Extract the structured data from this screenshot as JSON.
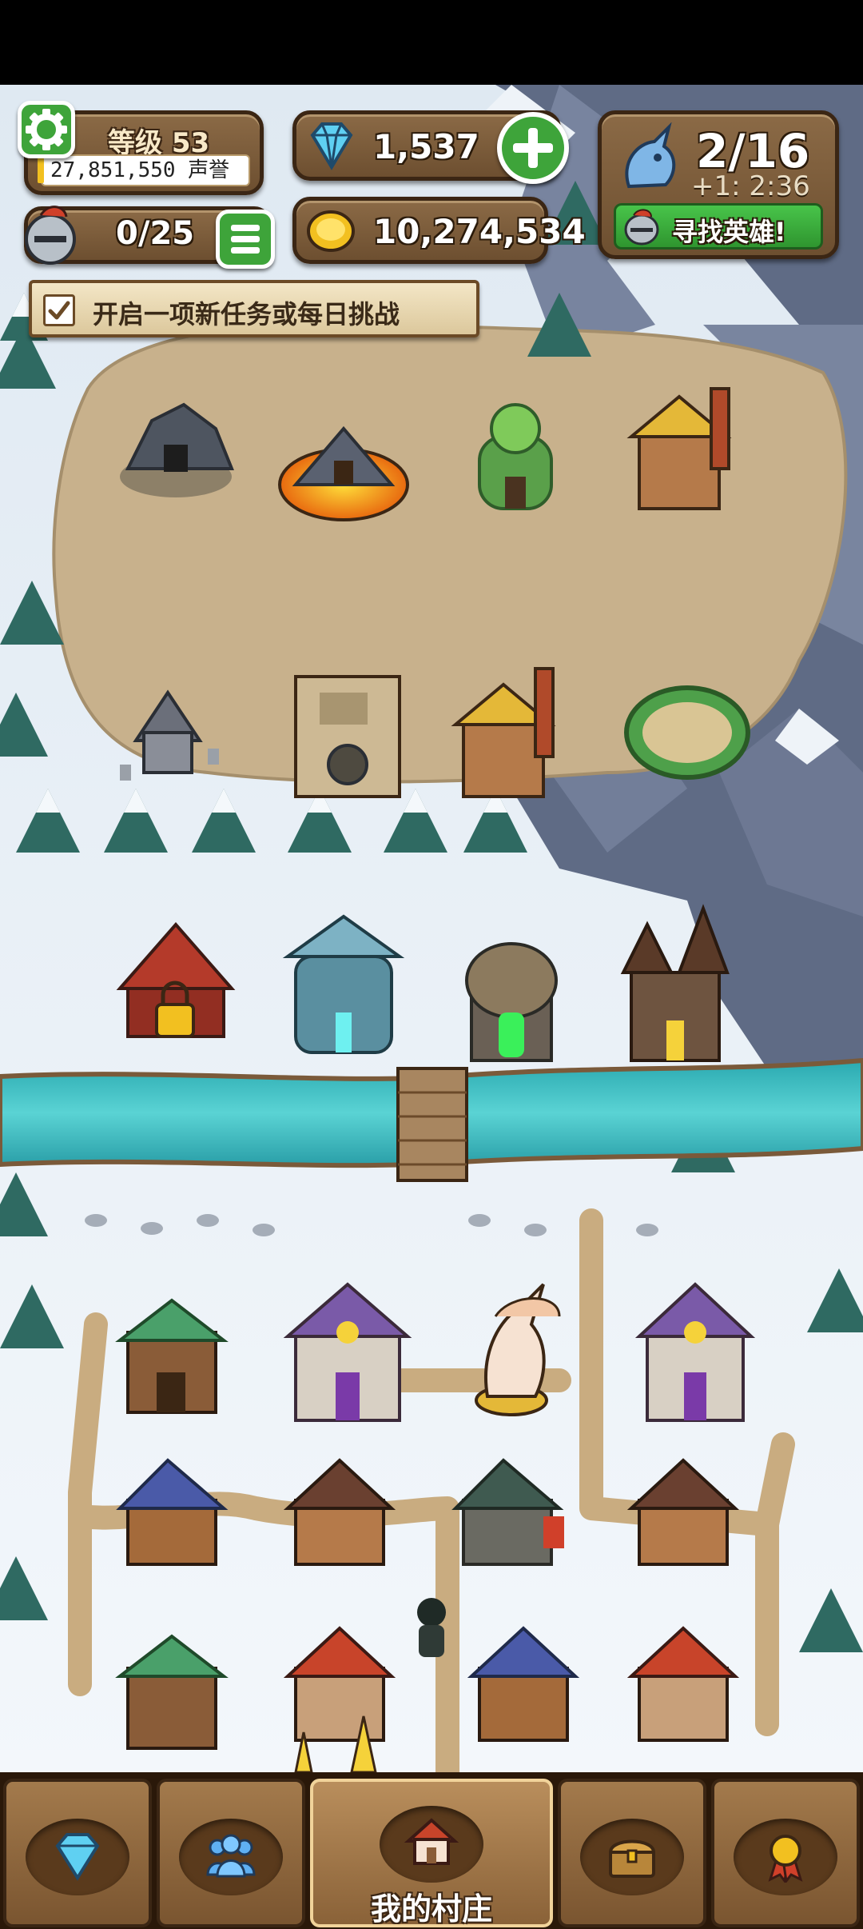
{
  "hud": {
    "level_label": "等级 53",
    "reputation": "27,851,550 声誉",
    "heroes_count": "0/25",
    "gems": "1,537",
    "gold": "10,274,534",
    "unicorn_count": "2/16",
    "unicorn_timer": "+1: 2:36",
    "find_hero_label": "寻找英雄!"
  },
  "quest_banner": {
    "text": "开启一项新任务或每日挑战"
  },
  "bottom_nav": {
    "tabs": [
      {
        "id": "gems",
        "icon": "diamond-icon"
      },
      {
        "id": "heroes",
        "icon": "people-icon"
      },
      {
        "id": "village",
        "icon": "house-icon",
        "label": "我的村庄",
        "active": true
      },
      {
        "id": "treasure",
        "icon": "treasure-chest-icon"
      },
      {
        "id": "achievements",
        "icon": "medal-icon"
      }
    ]
  },
  "colors": {
    "snow": "#e9f1f7",
    "dirt": "#c9b48e",
    "river": "#45c2c6",
    "hud_wood": "#7a5733",
    "button_green": "#3ea43a"
  }
}
